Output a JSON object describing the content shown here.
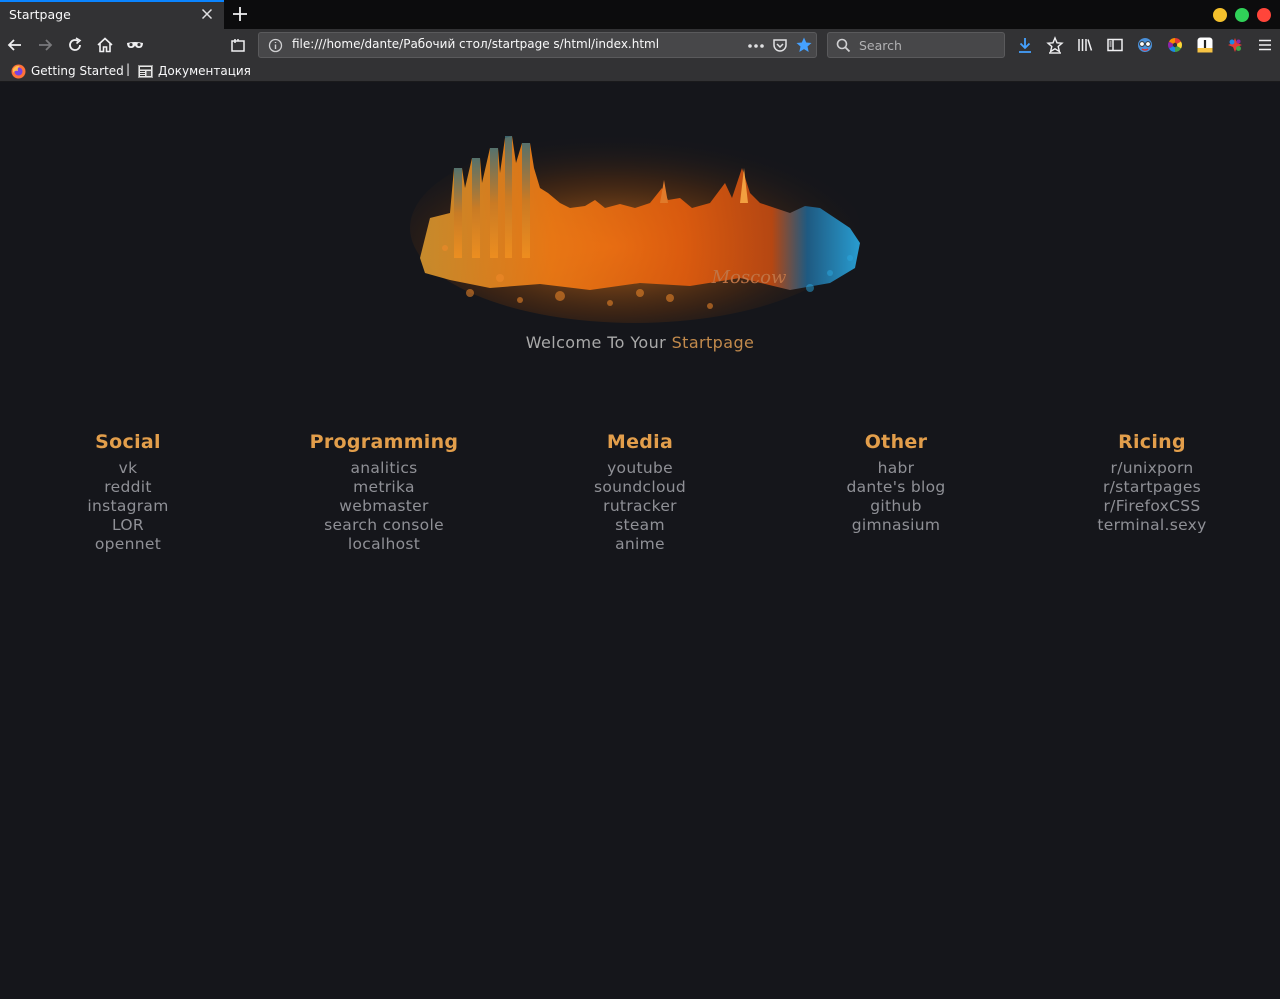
{
  "tab": {
    "title": "Startpage"
  },
  "navbar": {
    "url": "file:///home/dante/Рабочий стол/startpage s/html/index.html",
    "search_placeholder": "Search"
  },
  "bookmarks": [
    {
      "label": "Getting Started",
      "icon": "firefox-icon"
    },
    {
      "label": "Документация",
      "icon": "doc-icon"
    }
  ],
  "hero": {
    "caption": "Moscow"
  },
  "welcome": {
    "prefix": "Welcome To Your",
    "accent": "Startpage"
  },
  "colors": {
    "accent": "#e29e4b",
    "link": "#8f9096",
    "background": "#15161b",
    "tab_highlight": "#0a84ff"
  },
  "columns": [
    {
      "title": "Social",
      "links": [
        "vk",
        "reddit",
        "instagram",
        "LOR",
        "opennet"
      ]
    },
    {
      "title": "Programming",
      "links": [
        "analitics",
        "metrika",
        "webmaster",
        "search console",
        "localhost"
      ]
    },
    {
      "title": "Media",
      "links": [
        "youtube",
        "soundcloud",
        "rutracker",
        "steam",
        "anime"
      ]
    },
    {
      "title": "Other",
      "links": [
        "habr",
        "dante's blog",
        "github",
        "gimnasium"
      ]
    },
    {
      "title": "Ricing",
      "links": [
        "r/unixporn",
        "r/startpages",
        "r/FirefoxCSS",
        "terminal.sexy"
      ]
    }
  ]
}
